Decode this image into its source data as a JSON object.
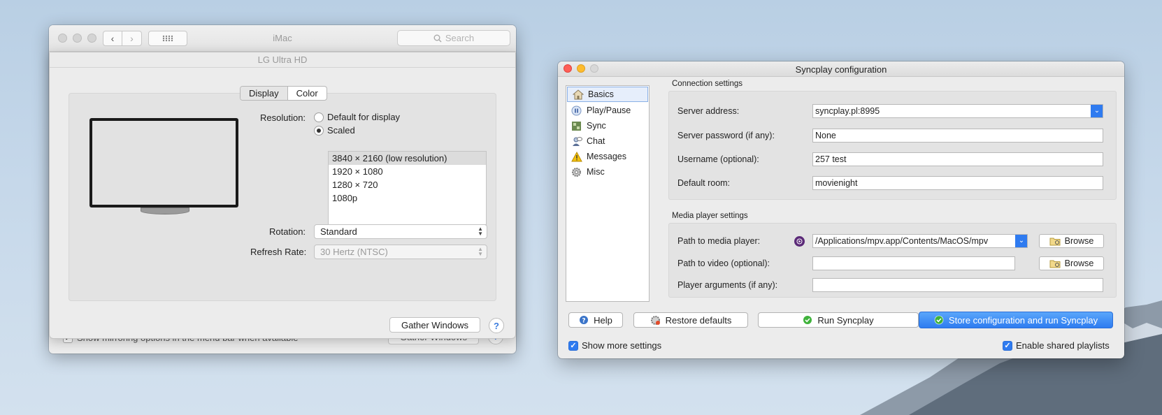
{
  "imac_window": {
    "title": "iMac",
    "search_placeholder": "Search",
    "behind_checkbox_label": "Show mirroring options in the menu bar when available",
    "behind_gather_label": "Gather Windows",
    "help_label": "?"
  },
  "display_window": {
    "title": "LG Ultra HD",
    "tabs": [
      {
        "label": "Display",
        "selected": true
      },
      {
        "label": "Color",
        "selected": false
      }
    ],
    "resolution_label": "Resolution:",
    "resolution_options": [
      "Default for display",
      "Scaled"
    ],
    "resolution_selected": "Scaled",
    "resolution_list": [
      "3840 × 2160 (low resolution)",
      "1920 × 1080",
      "1280 × 720",
      "1080p"
    ],
    "resolution_list_selected": "3840 × 2160 (low resolution)",
    "rotation_label": "Rotation:",
    "rotation_value": "Standard",
    "refresh_label": "Refresh Rate:",
    "refresh_value": "30 Hertz (NTSC)",
    "gather_label": "Gather Windows",
    "help_label": "?"
  },
  "syncplay": {
    "title": "Syncplay configuration",
    "sidebar": [
      {
        "label": "Basics",
        "icon": "house-icon",
        "selected": true
      },
      {
        "label": "Play/Pause",
        "icon": "pause-icon",
        "selected": false
      },
      {
        "label": "Sync",
        "icon": "sync-icon",
        "selected": false
      },
      {
        "label": "Chat",
        "icon": "chat-icon",
        "selected": false
      },
      {
        "label": "Messages",
        "icon": "warning-icon",
        "selected": false
      },
      {
        "label": "Misc",
        "icon": "gear-icon",
        "selected": false
      }
    ],
    "connection": {
      "title": "Connection settings",
      "server_address_label": "Server address:",
      "server_address_value": "syncplay.pl:8995",
      "password_label": "Server password (if any):",
      "password_value": "None",
      "username_label": "Username (optional):",
      "username_value": "257 test",
      "room_label": "Default room:",
      "room_value": "movienight"
    },
    "media": {
      "title": "Media player settings",
      "player_path_label": "Path to media player:",
      "player_path_value": "/Applications/mpv.app/Contents/MacOS/mpv",
      "video_path_label": "Path to video (optional):",
      "video_path_value": "",
      "args_label": "Player arguments (if any):",
      "args_value": "",
      "browse_label": "Browse"
    },
    "buttons": {
      "help": "Help",
      "restore": "Restore defaults",
      "run": "Run Syncplay",
      "store_run": "Store configuration and run Syncplay"
    },
    "show_more_label": "Show more settings",
    "shared_playlists_label": "Enable shared playlists",
    "accent_color": "#2f7bf0"
  }
}
